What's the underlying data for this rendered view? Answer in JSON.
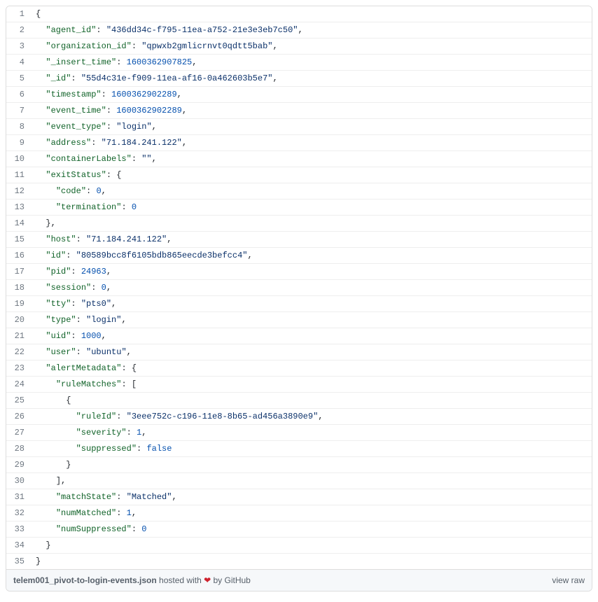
{
  "lines": [
    {
      "n": 1,
      "indent": 0,
      "tokens": [
        {
          "t": "punc",
          "v": "{"
        }
      ]
    },
    {
      "n": 2,
      "indent": 1,
      "tokens": [
        {
          "t": "key",
          "v": "\"agent_id\""
        },
        {
          "t": "punc",
          "v": ": "
        },
        {
          "t": "str",
          "v": "\"436dd34c-f795-11ea-a752-21e3e3eb7c50\""
        },
        {
          "t": "punc",
          "v": ","
        }
      ]
    },
    {
      "n": 3,
      "indent": 1,
      "tokens": [
        {
          "t": "key",
          "v": "\"organization_id\""
        },
        {
          "t": "punc",
          "v": ": "
        },
        {
          "t": "str",
          "v": "\"qpwxb2gmlicrnvt0qdtt5bab\""
        },
        {
          "t": "punc",
          "v": ","
        }
      ]
    },
    {
      "n": 4,
      "indent": 1,
      "tokens": [
        {
          "t": "key",
          "v": "\"_insert_time\""
        },
        {
          "t": "punc",
          "v": ": "
        },
        {
          "t": "num",
          "v": "1600362907825"
        },
        {
          "t": "punc",
          "v": ","
        }
      ]
    },
    {
      "n": 5,
      "indent": 1,
      "tokens": [
        {
          "t": "key",
          "v": "\"_id\""
        },
        {
          "t": "punc",
          "v": ": "
        },
        {
          "t": "str",
          "v": "\"55d4c31e-f909-11ea-af16-0a462603b5e7\""
        },
        {
          "t": "punc",
          "v": ","
        }
      ]
    },
    {
      "n": 6,
      "indent": 1,
      "tokens": [
        {
          "t": "key",
          "v": "\"timestamp\""
        },
        {
          "t": "punc",
          "v": ": "
        },
        {
          "t": "num",
          "v": "1600362902289"
        },
        {
          "t": "punc",
          "v": ","
        }
      ]
    },
    {
      "n": 7,
      "indent": 1,
      "tokens": [
        {
          "t": "key",
          "v": "\"event_time\""
        },
        {
          "t": "punc",
          "v": ": "
        },
        {
          "t": "num",
          "v": "1600362902289"
        },
        {
          "t": "punc",
          "v": ","
        }
      ]
    },
    {
      "n": 8,
      "indent": 1,
      "tokens": [
        {
          "t": "key",
          "v": "\"event_type\""
        },
        {
          "t": "punc",
          "v": ": "
        },
        {
          "t": "str",
          "v": "\"login\""
        },
        {
          "t": "punc",
          "v": ","
        }
      ]
    },
    {
      "n": 9,
      "indent": 1,
      "tokens": [
        {
          "t": "key",
          "v": "\"address\""
        },
        {
          "t": "punc",
          "v": ": "
        },
        {
          "t": "str",
          "v": "\"71.184.241.122\""
        },
        {
          "t": "punc",
          "v": ","
        }
      ]
    },
    {
      "n": 10,
      "indent": 1,
      "tokens": [
        {
          "t": "key",
          "v": "\"containerLabels\""
        },
        {
          "t": "punc",
          "v": ": "
        },
        {
          "t": "str",
          "v": "\"\""
        },
        {
          "t": "punc",
          "v": ","
        }
      ]
    },
    {
      "n": 11,
      "indent": 1,
      "tokens": [
        {
          "t": "key",
          "v": "\"exitStatus\""
        },
        {
          "t": "punc",
          "v": ": {"
        }
      ]
    },
    {
      "n": 12,
      "indent": 2,
      "tokens": [
        {
          "t": "key",
          "v": "\"code\""
        },
        {
          "t": "punc",
          "v": ": "
        },
        {
          "t": "num",
          "v": "0"
        },
        {
          "t": "punc",
          "v": ","
        }
      ]
    },
    {
      "n": 13,
      "indent": 2,
      "tokens": [
        {
          "t": "key",
          "v": "\"termination\""
        },
        {
          "t": "punc",
          "v": ": "
        },
        {
          "t": "num",
          "v": "0"
        }
      ]
    },
    {
      "n": 14,
      "indent": 1,
      "tokens": [
        {
          "t": "punc",
          "v": "},"
        }
      ]
    },
    {
      "n": 15,
      "indent": 1,
      "tokens": [
        {
          "t": "key",
          "v": "\"host\""
        },
        {
          "t": "punc",
          "v": ": "
        },
        {
          "t": "str",
          "v": "\"71.184.241.122\""
        },
        {
          "t": "punc",
          "v": ","
        }
      ]
    },
    {
      "n": 16,
      "indent": 1,
      "tokens": [
        {
          "t": "key",
          "v": "\"id\""
        },
        {
          "t": "punc",
          "v": ": "
        },
        {
          "t": "str",
          "v": "\"80589bcc8f6105bdb865eecde3befcc4\""
        },
        {
          "t": "punc",
          "v": ","
        }
      ]
    },
    {
      "n": 17,
      "indent": 1,
      "tokens": [
        {
          "t": "key",
          "v": "\"pid\""
        },
        {
          "t": "punc",
          "v": ": "
        },
        {
          "t": "num",
          "v": "24963"
        },
        {
          "t": "punc",
          "v": ","
        }
      ]
    },
    {
      "n": 18,
      "indent": 1,
      "tokens": [
        {
          "t": "key",
          "v": "\"session\""
        },
        {
          "t": "punc",
          "v": ": "
        },
        {
          "t": "num",
          "v": "0"
        },
        {
          "t": "punc",
          "v": ","
        }
      ]
    },
    {
      "n": 19,
      "indent": 1,
      "tokens": [
        {
          "t": "key",
          "v": "\"tty\""
        },
        {
          "t": "punc",
          "v": ": "
        },
        {
          "t": "str",
          "v": "\"pts0\""
        },
        {
          "t": "punc",
          "v": ","
        }
      ]
    },
    {
      "n": 20,
      "indent": 1,
      "tokens": [
        {
          "t": "key",
          "v": "\"type\""
        },
        {
          "t": "punc",
          "v": ": "
        },
        {
          "t": "str",
          "v": "\"login\""
        },
        {
          "t": "punc",
          "v": ","
        }
      ]
    },
    {
      "n": 21,
      "indent": 1,
      "tokens": [
        {
          "t": "key",
          "v": "\"uid\""
        },
        {
          "t": "punc",
          "v": ": "
        },
        {
          "t": "num",
          "v": "1000"
        },
        {
          "t": "punc",
          "v": ","
        }
      ]
    },
    {
      "n": 22,
      "indent": 1,
      "tokens": [
        {
          "t": "key",
          "v": "\"user\""
        },
        {
          "t": "punc",
          "v": ": "
        },
        {
          "t": "str",
          "v": "\"ubuntu\""
        },
        {
          "t": "punc",
          "v": ","
        }
      ]
    },
    {
      "n": 23,
      "indent": 1,
      "tokens": [
        {
          "t": "key",
          "v": "\"alertMetadata\""
        },
        {
          "t": "punc",
          "v": ": {"
        }
      ]
    },
    {
      "n": 24,
      "indent": 2,
      "tokens": [
        {
          "t": "key",
          "v": "\"ruleMatches\""
        },
        {
          "t": "punc",
          "v": ": ["
        }
      ]
    },
    {
      "n": 25,
      "indent": 3,
      "tokens": [
        {
          "t": "punc",
          "v": "{"
        }
      ]
    },
    {
      "n": 26,
      "indent": 4,
      "tokens": [
        {
          "t": "key",
          "v": "\"ruleId\""
        },
        {
          "t": "punc",
          "v": ": "
        },
        {
          "t": "str",
          "v": "\"3eee752c-c196-11e8-8b65-ad456a3890e9\""
        },
        {
          "t": "punc",
          "v": ","
        }
      ]
    },
    {
      "n": 27,
      "indent": 4,
      "tokens": [
        {
          "t": "key",
          "v": "\"severity\""
        },
        {
          "t": "punc",
          "v": ": "
        },
        {
          "t": "num",
          "v": "1"
        },
        {
          "t": "punc",
          "v": ","
        }
      ]
    },
    {
      "n": 28,
      "indent": 4,
      "tokens": [
        {
          "t": "key",
          "v": "\"suppressed\""
        },
        {
          "t": "punc",
          "v": ": "
        },
        {
          "t": "bool",
          "v": "false"
        }
      ]
    },
    {
      "n": 29,
      "indent": 3,
      "tokens": [
        {
          "t": "punc",
          "v": "}"
        }
      ]
    },
    {
      "n": 30,
      "indent": 2,
      "tokens": [
        {
          "t": "punc",
          "v": "],"
        }
      ]
    },
    {
      "n": 31,
      "indent": 2,
      "tokens": [
        {
          "t": "key",
          "v": "\"matchState\""
        },
        {
          "t": "punc",
          "v": ": "
        },
        {
          "t": "str",
          "v": "\"Matched\""
        },
        {
          "t": "punc",
          "v": ","
        }
      ]
    },
    {
      "n": 32,
      "indent": 2,
      "tokens": [
        {
          "t": "key",
          "v": "\"numMatched\""
        },
        {
          "t": "punc",
          "v": ": "
        },
        {
          "t": "num",
          "v": "1"
        },
        {
          "t": "punc",
          "v": ","
        }
      ]
    },
    {
      "n": 33,
      "indent": 2,
      "tokens": [
        {
          "t": "key",
          "v": "\"numSuppressed\""
        },
        {
          "t": "punc",
          "v": ": "
        },
        {
          "t": "num",
          "v": "0"
        }
      ]
    },
    {
      "n": 34,
      "indent": 1,
      "tokens": [
        {
          "t": "punc",
          "v": "}"
        }
      ]
    },
    {
      "n": 35,
      "indent": 0,
      "tokens": [
        {
          "t": "punc",
          "v": "}"
        }
      ]
    }
  ],
  "meta": {
    "filename": "telem001_pivot-to-login-events.json",
    "hosted_prefix": " hosted with ",
    "hosted_suffix": " by ",
    "github": "GitHub",
    "view_raw": "view raw"
  }
}
